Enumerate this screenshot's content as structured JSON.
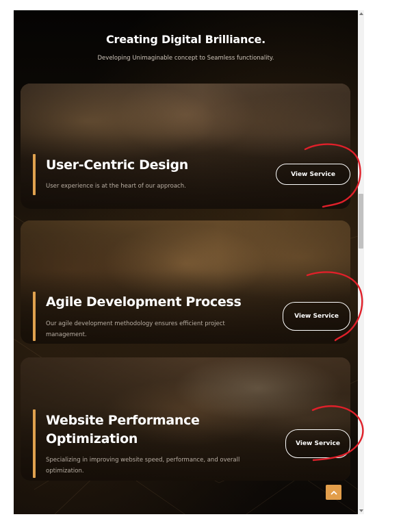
{
  "section": {
    "title": "Creating Digital Brilliance.",
    "subtitle": "Developing Unimaginable concept to Seamless functionality."
  },
  "services": [
    {
      "title": "User-Centric Design",
      "description": "User experience is at the heart of our approach.",
      "button_label": "View Service"
    },
    {
      "title": "Agile Development Process",
      "description": "Our agile development methodology ensures efficient project management.",
      "button_label": "View Service"
    },
    {
      "title": "Website Performance Optimization",
      "description": "Specializing in improving website speed, performance, and overall optimization.",
      "button_label": "View Service"
    }
  ],
  "icons": {
    "scroll_to_top": "chevron-up-icon",
    "scroll_up": "triangle-up-icon",
    "scroll_down": "triangle-down-icon"
  },
  "colors": {
    "page_background": "#0a0806",
    "accent": "#e0a24f",
    "annotation": "#e0202a",
    "text_primary": "#ffffff",
    "text_muted": "#b9afa4"
  }
}
